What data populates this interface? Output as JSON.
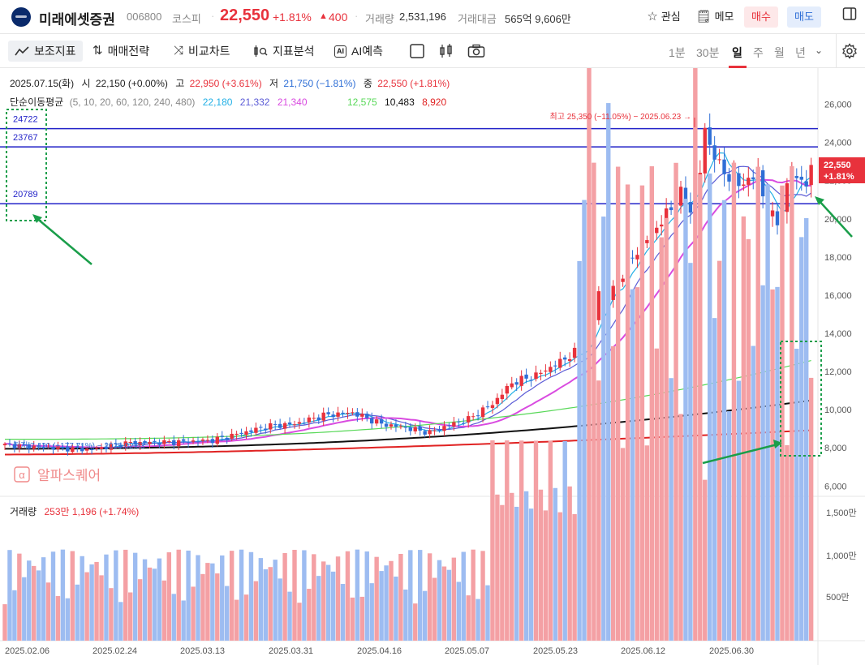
{
  "header": {
    "stock_name": "미래에셋증권",
    "stock_code": "006800",
    "market": "코스피",
    "price": "22,550",
    "change_rate": "+1.81%",
    "change_arrow": "▲",
    "change_amount": "400",
    "volume_label": "거래량",
    "volume_value": "2,531,196",
    "turnover_label": "거래대금",
    "turnover_value": "565억 9,606만",
    "watch_label": "관심",
    "memo_label": "메모",
    "buy_label": "매수",
    "sell_label": "매도"
  },
  "toolbar": {
    "indicators": "보조지표",
    "strategy": "매매전략",
    "compare": "비교차트",
    "analysis": "지표분석",
    "ai_predict": "AI예측",
    "ai_badge": "AI",
    "periods": [
      "1분",
      "30분",
      "일",
      "주",
      "월",
      "년"
    ],
    "active_period": "일"
  },
  "legend": {
    "date": "2025.07.15(화)",
    "open_label": "시",
    "open": "22,150 (+0.00%)",
    "high_label": "고",
    "high": "22,950 (+3.61%)",
    "low_label": "저",
    "low": "21,750 (−1.81%)",
    "close_label": "종",
    "close": "22,550 (+1.81%)",
    "ma_label": "단순이동평균",
    "ma_periods": "(5, 10, 20, 60, 120, 240, 480)",
    "ma_values": [
      "22,180",
      "21,332",
      "21,340",
      "12,575",
      "10,483",
      "8,920"
    ],
    "ma_colors": [
      "#23b0e6",
      "#5b5bd6",
      "#d94be0",
      "#58d858",
      "#111111",
      "#e02222"
    ]
  },
  "annotations": {
    "high_note": "최고 25,350 (−11.05%) − 2025.06.23 →",
    "low_note": "최저 7,420 (+177.71%) − 2025.02.03",
    "levels": [
      "24722",
      "23767",
      "20789"
    ],
    "price_tag": "22,550",
    "price_tag_rate": "+1.81%",
    "watermark": "알파스퀘어",
    "watermark_icon": "α",
    "volume_label": "거래량",
    "volume_value": "253만 1,196 (+1.74%)"
  },
  "chart_data": {
    "type": "candlestick",
    "y_ticks": [
      "26,000",
      "24,000",
      "22,000",
      "20,000",
      "18,000",
      "16,000",
      "14,000",
      "12,000",
      "10,000",
      "8,000",
      "6,000"
    ],
    "ylim": [
      6000,
      26000
    ],
    "volume_ticks": [
      "1,500만",
      "1,000만",
      "500만"
    ],
    "x_labels": [
      "2025.02.06",
      "2025.02.24",
      "2025.03.13",
      "2025.03.31",
      "2025.04.16",
      "2025.05.07",
      "2025.05.23",
      "2025.06.12",
      "2025.06.30"
    ],
    "horizontal_levels": [
      24722,
      23767,
      20789
    ],
    "last_close": 22550,
    "colors": {
      "up": "#e8323c",
      "down": "#2f6fd6",
      "vol_up": "#f4a0a4",
      "vol_down": "#9dbcf1",
      "level": "#2323c8",
      "annot": "#1a9e4a"
    }
  }
}
